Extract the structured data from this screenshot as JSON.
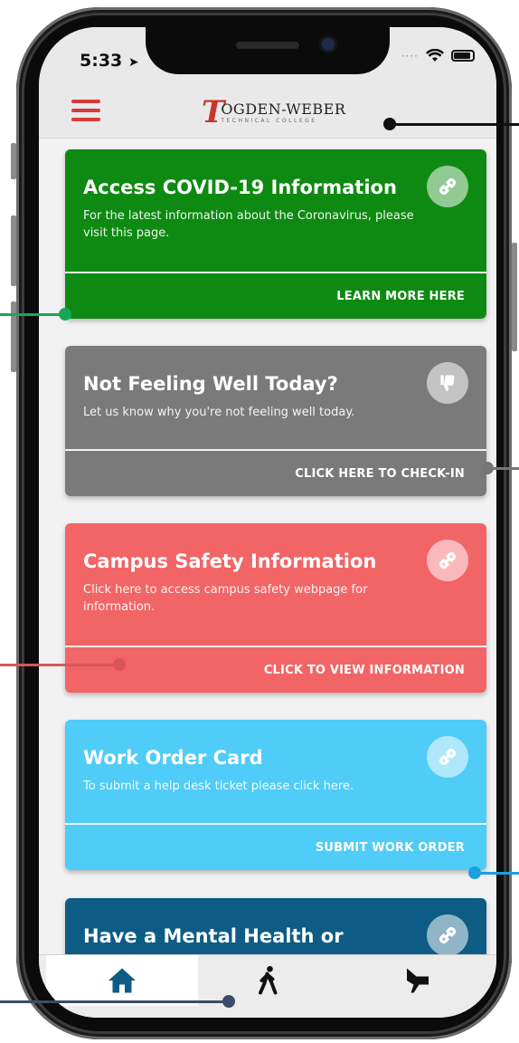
{
  "status_bar": {
    "time": "5:33"
  },
  "header": {
    "logo_mark": "T",
    "logo_main": "OGDEN-WEBER",
    "logo_sub": "TECHNICAL COLLEGE"
  },
  "cards": [
    {
      "title": "Access COVID-19 Information",
      "description": "For the latest information about the Coronavirus, please visit this page.",
      "action": "LEARN MORE HERE",
      "icon": "link-icon",
      "color": "#0e8a12"
    },
    {
      "title": "Not Feeling Well Today?",
      "description": "Let us know why you're not feeling well today.",
      "action": "CLICK HERE TO CHECK-IN",
      "icon": "thumbs-down-icon",
      "color": "#7a7a7a"
    },
    {
      "title": "Campus Safety Information",
      "description": "Click here to access campus safety webpage for information.",
      "action": "CLICK TO VIEW INFORMATION",
      "icon": "link-icon",
      "color": "#f26566"
    },
    {
      "title": "Work Order Card",
      "description": "To submit a help desk ticket please click here.",
      "action": "SUBMIT WORK ORDER",
      "icon": "link-icon",
      "color": "#4fccf7"
    },
    {
      "title": "Have a Mental Health or",
      "icon": "link-icon",
      "color": "#0d5c86"
    }
  ],
  "tabbar": {
    "tabs": [
      {
        "icon": "home-icon",
        "active": true
      },
      {
        "icon": "walking-person-icon",
        "active": false
      },
      {
        "icon": "megaphone-icon",
        "active": false
      }
    ],
    "accent_color": "#0d5c86"
  },
  "callout_colors": {
    "header": "#111111",
    "covid": "#1aa659",
    "wellness": "#777777",
    "safety": "#d8565a",
    "workorder": "#1aa0e0",
    "tabbar": "#3c4a6b"
  }
}
